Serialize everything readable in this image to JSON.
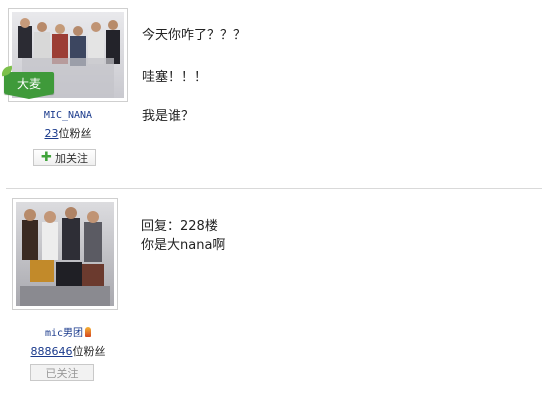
{
  "posts": [
    {
      "badge": "大麦",
      "username": "MIC_NANA",
      "fans_count": "23",
      "fans_suffix": "位粉丝",
      "follow_label": "加关注",
      "follow_icon": "plus-icon",
      "lines": [
        "今天你咋了？？？",
        "哇塞！！！",
        "我是谁？"
      ]
    },
    {
      "username": "mic男团",
      "username_icon": "fire-icon",
      "fans_count": "888646",
      "fans_suffix": "位粉丝",
      "follow_label": "已关注",
      "lines": [
        "回复：228楼",
        "你是大nana啊"
      ]
    }
  ],
  "colors": {
    "badge_green": "#3f9a3a",
    "link_blue": "#1a3a8c",
    "divider": "#d9d9d9"
  }
}
